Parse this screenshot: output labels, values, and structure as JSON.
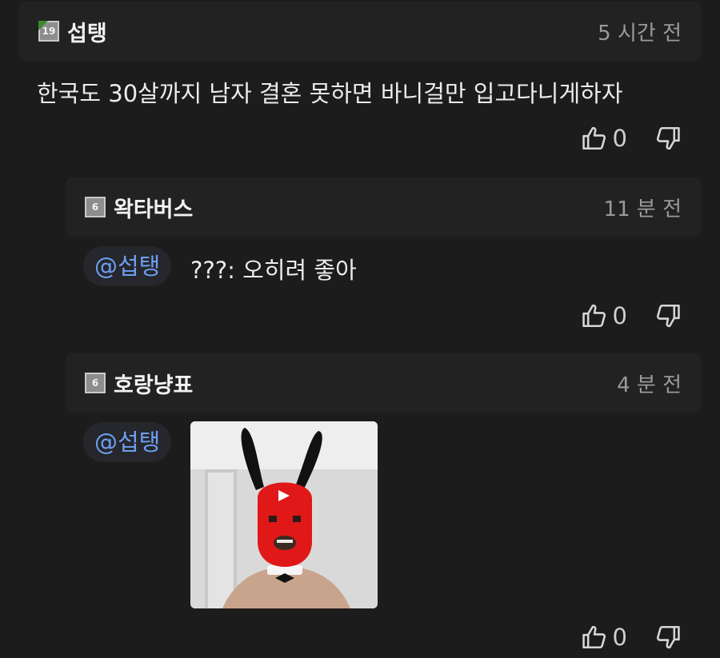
{
  "comments": [
    {
      "badge": "19",
      "username": "섭탱",
      "time": "5 시간 전",
      "text": "한국도 30살까지 남자 결혼 못하면 바니걸만 입고다니게하자",
      "likes": "0"
    },
    {
      "badge": "6",
      "username": "왁타버스",
      "time": "11 분 전",
      "mention": "@섭탱",
      "text": "???: 오히려 좋아",
      "likes": "0"
    },
    {
      "badge": "6",
      "username": "호랑냥표",
      "time": "4 분 전",
      "mention": "@섭탱",
      "has_image": true,
      "likes": "0"
    }
  ],
  "icons": {
    "like": "thumbs-up-icon",
    "dislike": "thumbs-down-icon"
  },
  "colors": {
    "background": "#1c1c1c",
    "header": "#222222",
    "mention": "#6e9ef0",
    "badge_new": "#3a8a2c"
  }
}
